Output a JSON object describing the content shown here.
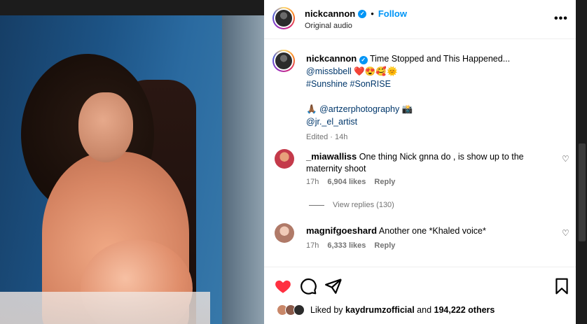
{
  "post": {
    "username": "nickcannon",
    "follow_label": "Follow",
    "separator": "•",
    "audio": "Original audio",
    "more": "•••"
  },
  "caption": {
    "username": "nickcannon",
    "text": "Time Stopped and This Happened...",
    "mention": "@missbbell",
    "emojis": "❤️😍🥰🌞",
    "hashtags": "#Sunshine #SonRISE",
    "pray": "🙏🏾",
    "photographer": "@artzerphotography",
    "camera": "📸",
    "artist": "@jr._el_artist",
    "meta": "Edited · 14h"
  },
  "comments": [
    {
      "username": "_miawalliss",
      "text": "One thing Nick gnna do , is show up to the maternity shoot",
      "time": "17h",
      "likes": "6,904 likes",
      "reply": "Reply",
      "view_replies": "View replies (130)",
      "avatar_color": "#c43a4a"
    },
    {
      "username": "magnifgoeshard",
      "text": "Another one *Khaled voice*",
      "time": "17h",
      "likes": "6,333 likes",
      "reply": "Reply",
      "avatar_color": "#b07a68"
    }
  ],
  "actions": {
    "liked_by_prefix": "Liked by",
    "liked_by_user": "kaydrumzofficial",
    "and": "and",
    "others": "194,222 others",
    "heart_color": "#ff3040"
  }
}
